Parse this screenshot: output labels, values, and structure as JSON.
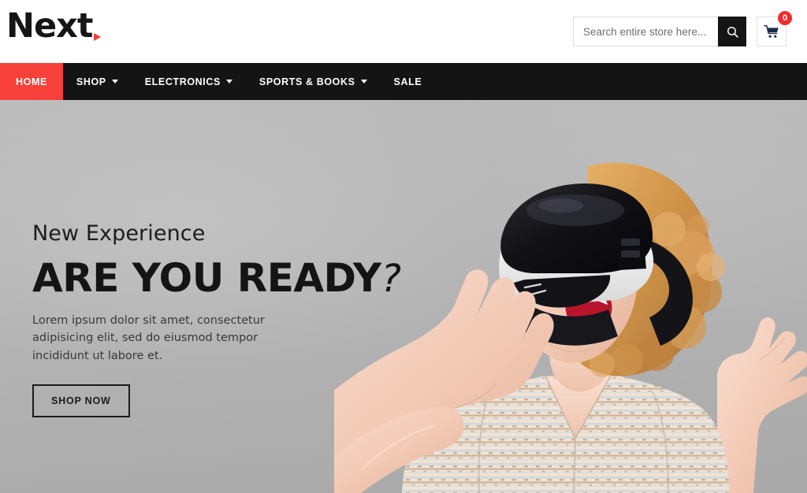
{
  "brand": {
    "name": "Next",
    "accent_color": "#f8403a"
  },
  "header": {
    "search": {
      "placeholder": "Search entire store here...",
      "value": "",
      "icon": "search-icon"
    },
    "cart": {
      "icon": "shopping-cart-icon",
      "count": "0",
      "badge_color": "#f02d2d"
    }
  },
  "nav": {
    "background_color": "#141414",
    "items": [
      {
        "label": "HOME",
        "active": true,
        "has_dropdown": false
      },
      {
        "label": "SHOP",
        "active": false,
        "has_dropdown": true
      },
      {
        "label": "ELECTRONICS",
        "active": false,
        "has_dropdown": true
      },
      {
        "label": "SPORTS & BOOKS",
        "active": false,
        "has_dropdown": true
      },
      {
        "label": "SALE",
        "active": false,
        "has_dropdown": false
      }
    ]
  },
  "hero": {
    "kicker": "New Experience",
    "title_main": "ARE YOU READY",
    "title_mark": "?",
    "subtitle": "Lorem ipsum dolor sit amet, consectetur adipisicing elit, sed do eiusmod tempor incididunt ut labore et.",
    "cta_label": "SHOP NOW",
    "background_color": "#b6b6b6",
    "image_alt": "woman-wearing-vr-headset"
  }
}
